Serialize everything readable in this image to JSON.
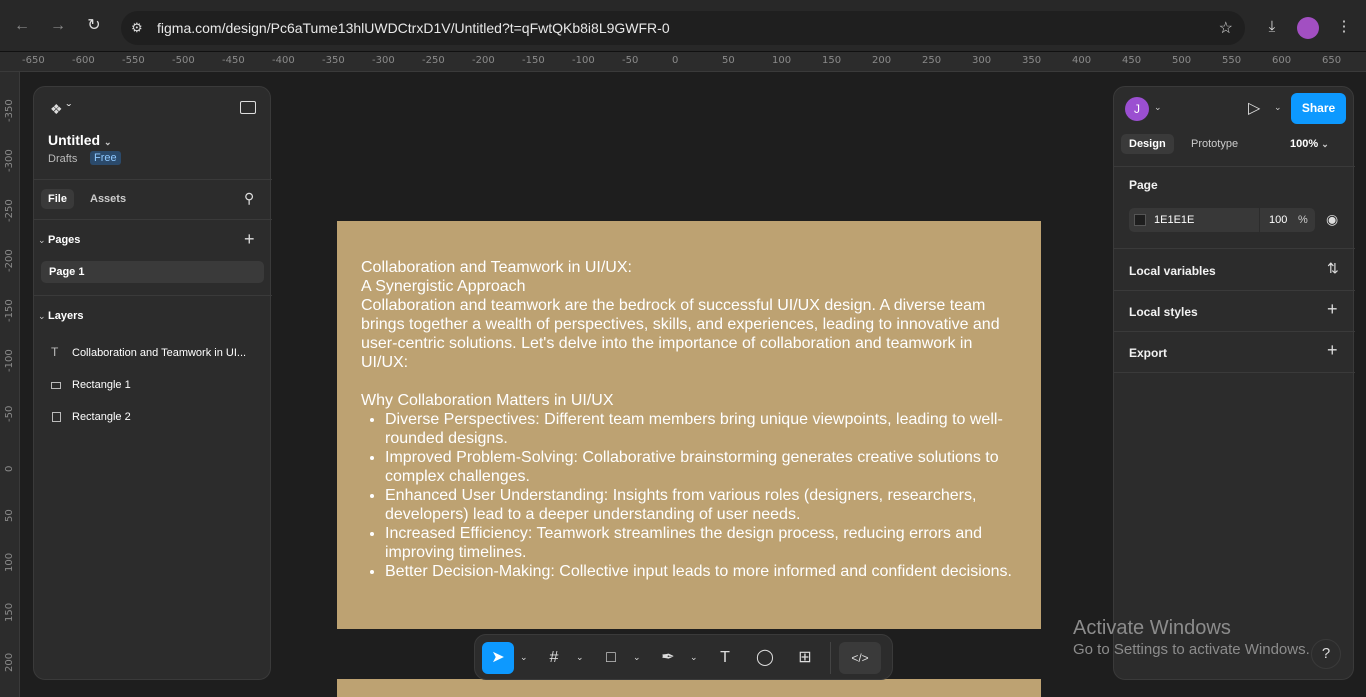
{
  "browser": {
    "url": "figma.com/design/Pc6aTume13hlUWDCtrxD1V/Untitled?t=qFwtQKb8i8L9GWFR-0",
    "back_icon": "arrow-left-icon",
    "forward_icon": "arrow-right-icon",
    "reload_icon": "reload-icon"
  },
  "ruler": {
    "top_ticks": [
      "-650",
      "-600",
      "-550",
      "-500",
      "-450",
      "-400",
      "-350",
      "-300",
      "-250",
      "-200",
      "-150",
      "-100",
      "-50",
      "0",
      "50",
      "100",
      "150",
      "200",
      "250",
      "300",
      "350",
      "400",
      "450",
      "500",
      "550",
      "600",
      "650"
    ],
    "left_ticks": [
      "-350",
      "-300",
      "-250",
      "-200",
      "-150",
      "-100",
      "-50",
      "0",
      "50",
      "100",
      "150",
      "200"
    ]
  },
  "left_panel": {
    "file_title": "Untitled",
    "drafts_label": "Drafts",
    "plan_badge": "Free",
    "tabs": {
      "file": "File",
      "assets": "Assets"
    },
    "pages_heading": "Pages",
    "page_item": "Page 1",
    "layers_heading": "Layers",
    "layers": [
      {
        "name": "Collaboration and Teamwork in UI...",
        "icon": "text-icon"
      },
      {
        "name": "Rectangle 1",
        "icon": "rectangle-icon"
      },
      {
        "name": "Rectangle 2",
        "icon": "frame-icon"
      }
    ]
  },
  "right_panel": {
    "user_initial": "J",
    "share_label": "Share",
    "tabs": {
      "design": "Design",
      "prototype": "Prototype"
    },
    "zoom": "100%",
    "page_heading": "Page",
    "page_color": "1E1E1E",
    "page_opacity": "100",
    "percent_sign": "%",
    "local_variables": "Local variables",
    "local_styles": "Local styles",
    "export": "Export"
  },
  "canvas": {
    "title_line1": "Collaboration and Teamwork in UI/UX:",
    "title_line2": "A Synergistic Approach",
    "intro": "Collaboration and teamwork are the bedrock of successful UI/UX design. A diverse team brings together a wealth of perspectives, skills, and experiences, leading to innovative and user-centric solutions. Let's delve into the importance of collaboration and teamwork in UI/UX:",
    "subheading": "Why Collaboration Matters in UI/UX",
    "bullets": [
      "Diverse Perspectives: Different team members bring unique viewpoints, leading to well-rounded designs.",
      "Improved Problem-Solving: Collaborative brainstorming generates creative solutions to complex challenges.",
      "Enhanced User Understanding: Insights from various roles (designers, researchers, developers) lead to a deeper understanding of user needs.",
      "Increased Efficiency: Teamwork streamlines the design process, reducing errors and improving timelines.",
      "Better Decision-Making: Collective input leads to more informed and confident decisions."
    ],
    "artboard_color": "#bda272"
  },
  "watermark": {
    "line1": "Activate Windows",
    "line2": "Go to Settings to activate Windows."
  },
  "help_label": "?",
  "accent": "#0d99ff"
}
